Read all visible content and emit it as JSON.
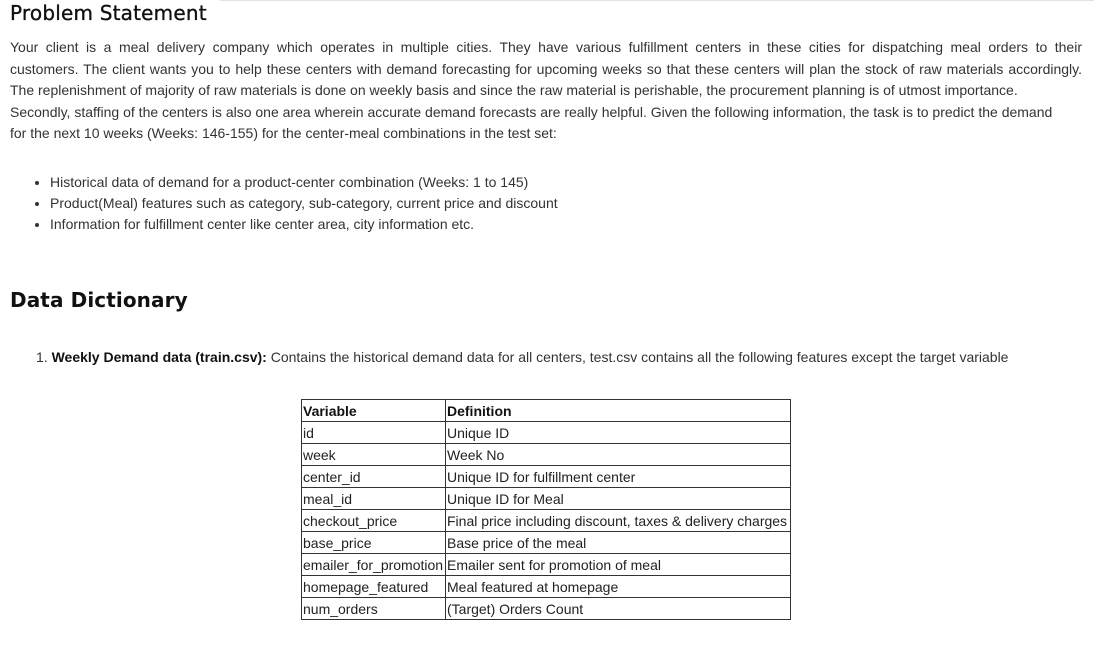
{
  "problem_statement": {
    "title": "Problem Statement",
    "paragraph_lines": [
      "Your client is a meal delivery company which operates in multiple cities. They have various fulfillment centers in these cities for dispatching meal orders to their",
      "customers. The client wants you to help these centers with demand forecasting for upcoming weeks so that these centers will plan the stock of raw materials accordingly.",
      "The replenishment of majority of raw materials is done on weekly basis and since the raw material is perishable, the procurement planning is of utmost importance.",
      "Secondly, staffing of the centers is also one area wherein accurate demand forecasts are really helpful. Given the following information, the task is to predict the demand",
      "for the next 10 weeks (Weeks: 146-155) for the center-meal combinations in the test set:"
    ],
    "bullets": [
      "Historical data of demand for a product-center combination (Weeks: 1 to 145)",
      "Product(Meal) features such as category, sub-category, current price and discount",
      "Information for fulfillment center like center area, city information etc."
    ]
  },
  "data_dictionary": {
    "title": "Data Dictionary",
    "item_number": "1.",
    "item_label": "Weekly Demand data (train.csv):",
    "item_text": " Contains the historical demand data for all centers, test.csv contains all the following features except the target variable",
    "table": {
      "headers": [
        "Variable",
        "Definition"
      ],
      "rows": [
        [
          "id",
          "Unique ID"
        ],
        [
          "week",
          "Week No"
        ],
        [
          "center_id",
          "Unique ID for fulfillment center"
        ],
        [
          "meal_id",
          "Unique ID for Meal"
        ],
        [
          "checkout_price",
          "Final price including discount, taxes & delivery charges"
        ],
        [
          "base_price",
          "Base price of the meal"
        ],
        [
          "emailer_for_promotion",
          "Emailer sent for promotion of meal"
        ],
        [
          "homepage_featured",
          "Meal featured at homepage"
        ],
        [
          "num_orders",
          "(Target) Orders Count"
        ]
      ]
    }
  }
}
